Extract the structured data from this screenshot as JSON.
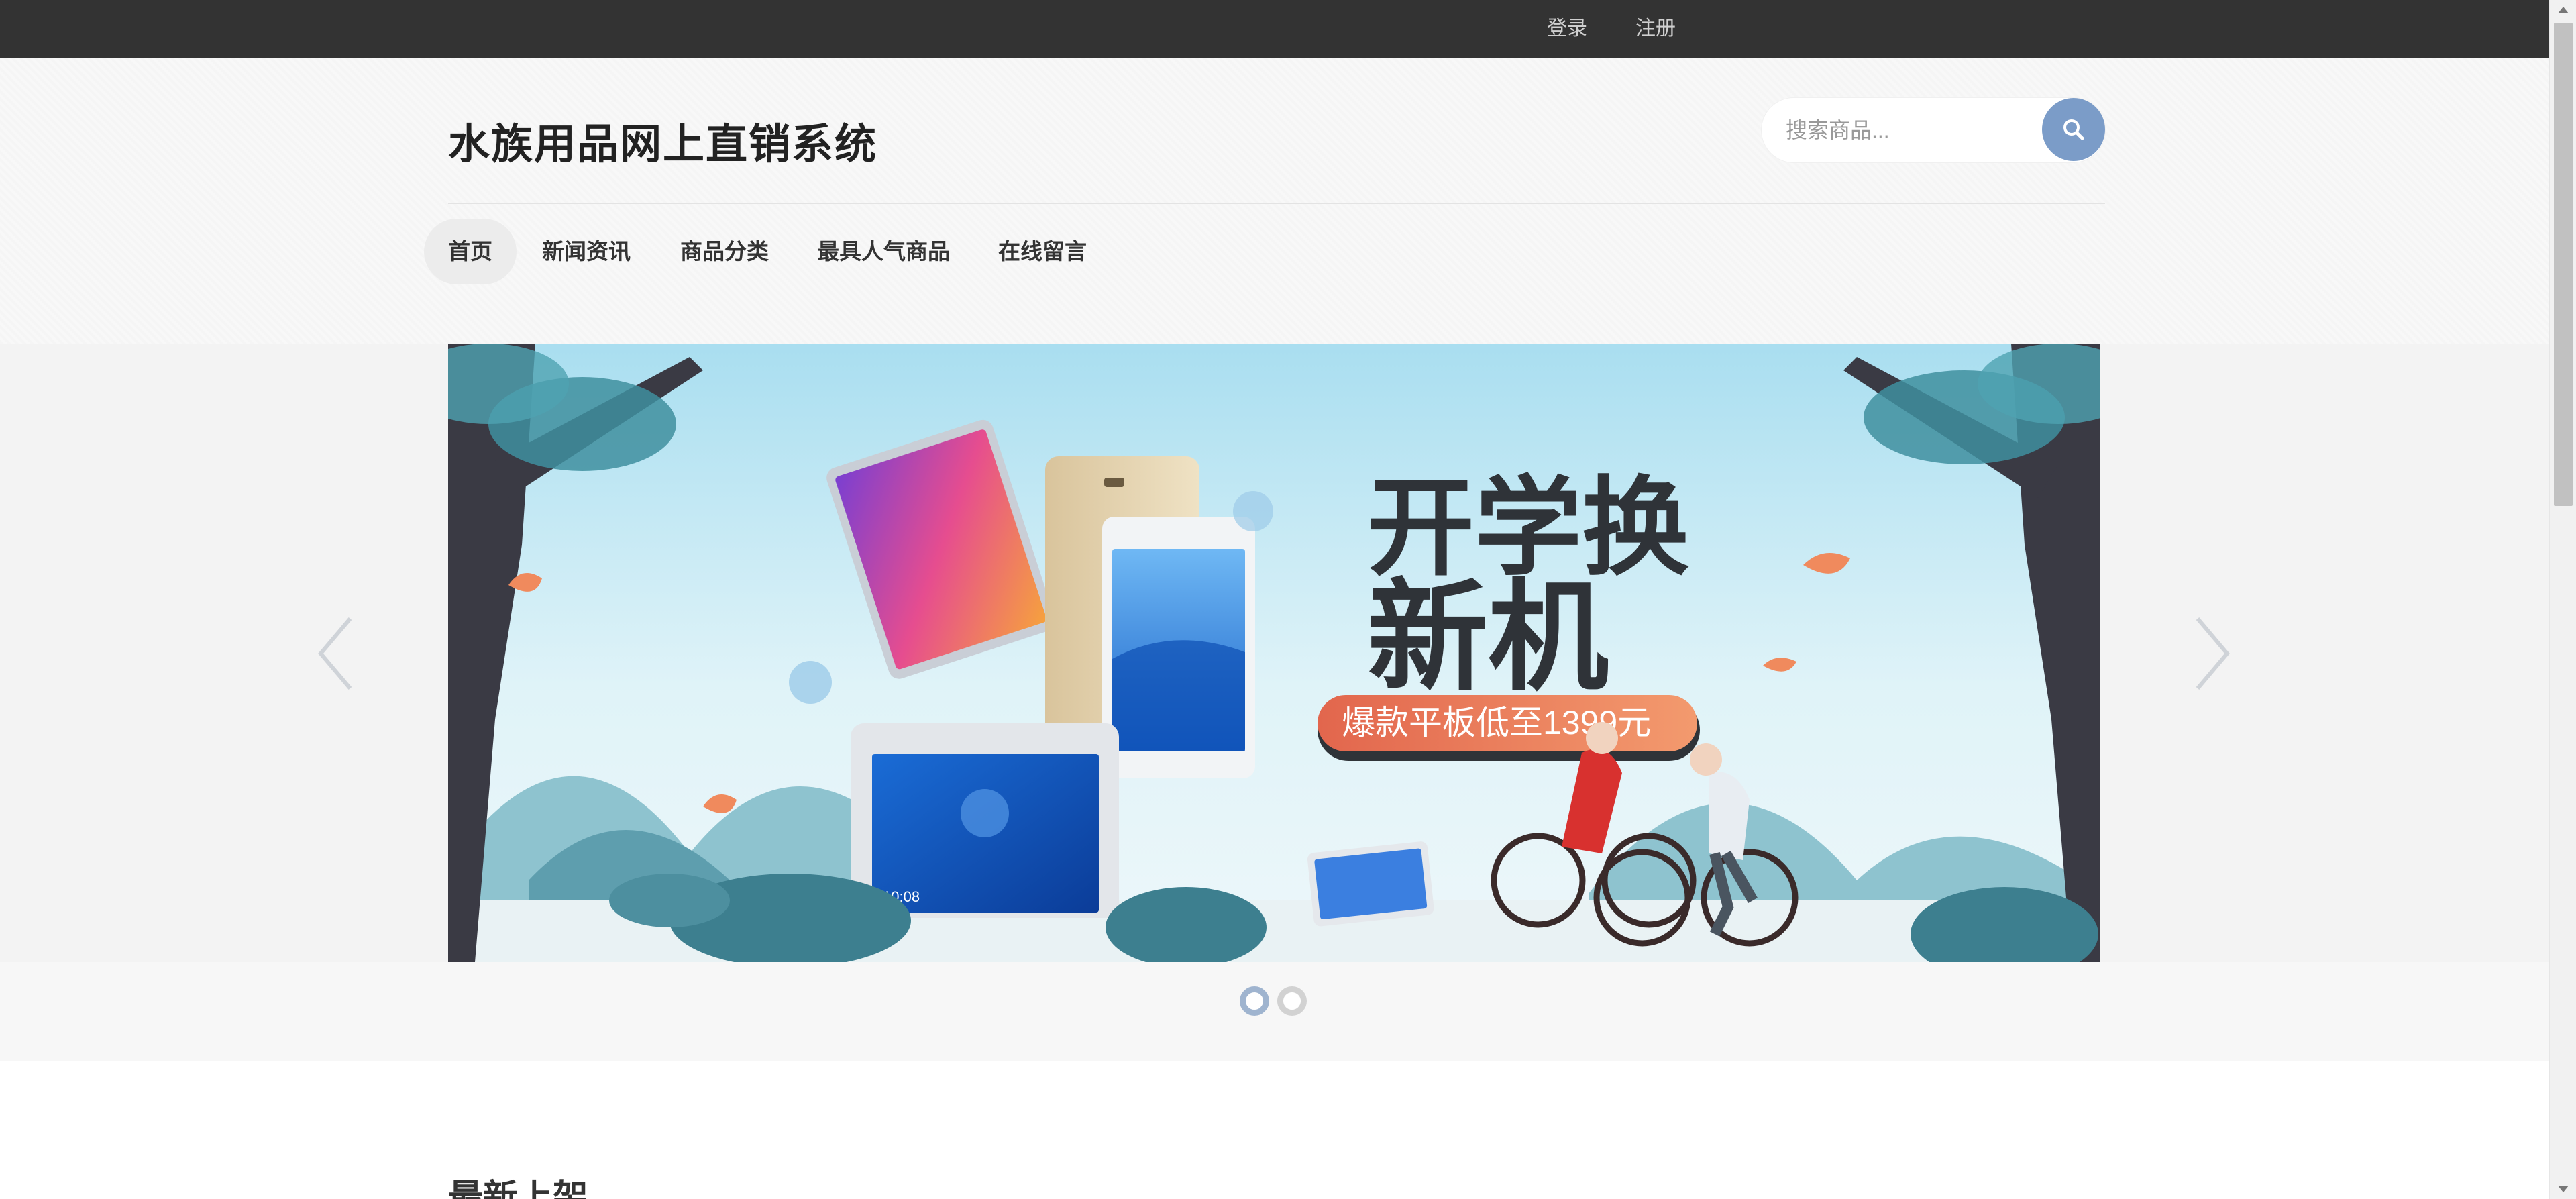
{
  "topbar": {
    "login_label": "登录",
    "register_label": "注册"
  },
  "header": {
    "site_title": "水族用品网上直销系统",
    "search": {
      "placeholder": "搜索商品...",
      "value": ""
    }
  },
  "nav": {
    "items": [
      {
        "label": "首页",
        "active": true
      },
      {
        "label": "新闻资讯",
        "active": false
      },
      {
        "label": "商品分类",
        "active": false
      },
      {
        "label": "最具人气商品",
        "active": false
      },
      {
        "label": "在线留言",
        "active": false
      }
    ]
  },
  "banner": {
    "headline_line1": "开学换",
    "headline_line2": "新机",
    "promo_text": "爆款平板低至1399元",
    "tablet_time": "10:08",
    "slide_count": 2,
    "active_slide": 1
  },
  "sections": {
    "latest_title": "最新上架"
  },
  "colors": {
    "accent": "#7b9cc8",
    "topbar": "#333333",
    "promo": "#e8785a"
  }
}
